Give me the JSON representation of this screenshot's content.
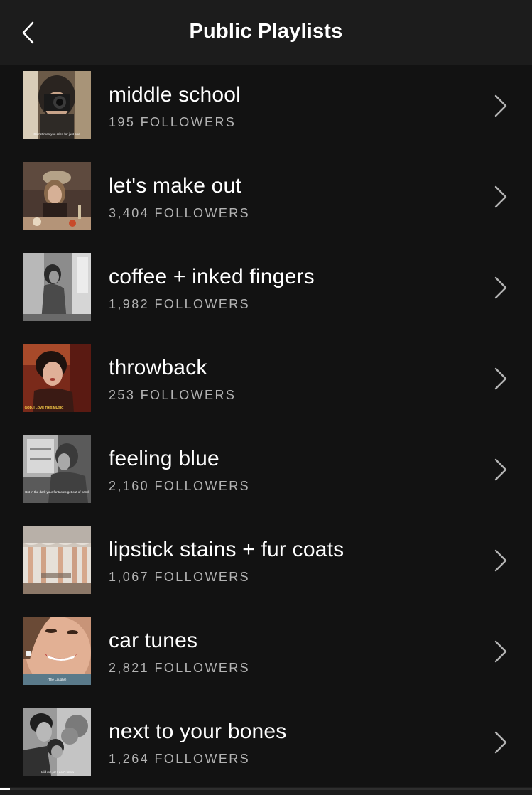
{
  "header": {
    "title": "Public Playlists",
    "back_icon": "chevron-left-icon"
  },
  "colors": {
    "background": "#121212",
    "header": "#1c1c1c",
    "subtext": "#b3b3b3",
    "chevron": "#b3b3b3"
  },
  "playlists": [
    {
      "title": "middle school",
      "followers": "195 FOLLOWERS",
      "thumb_caption": "Sometimes you cries for just one"
    },
    {
      "title": "let's make out",
      "followers": "3,404 FOLLOWERS",
      "thumb_caption": ""
    },
    {
      "title": "coffee + inked fingers",
      "followers": "1,982 FOLLOWERS",
      "thumb_caption": ""
    },
    {
      "title": "throwback",
      "followers": "253 FOLLOWERS",
      "thumb_caption": "GOD, I LOVE THIS MUSIC"
    },
    {
      "title": "feeling blue",
      "followers": "2,160 FOLLOWERS",
      "thumb_caption": "But in the dark your fantasies get out of hand"
    },
    {
      "title": "lipstick stains + fur coats",
      "followers": "1,067 FOLLOWERS",
      "thumb_caption": ""
    },
    {
      "title": "car tunes",
      "followers": "2,821 FOLLOWERS",
      "thumb_caption": "(The Laughs)"
    },
    {
      "title": "next to your bones",
      "followers": "1,264 FOLLOWERS",
      "thumb_caption": "Hold me, or I don't know"
    }
  ]
}
